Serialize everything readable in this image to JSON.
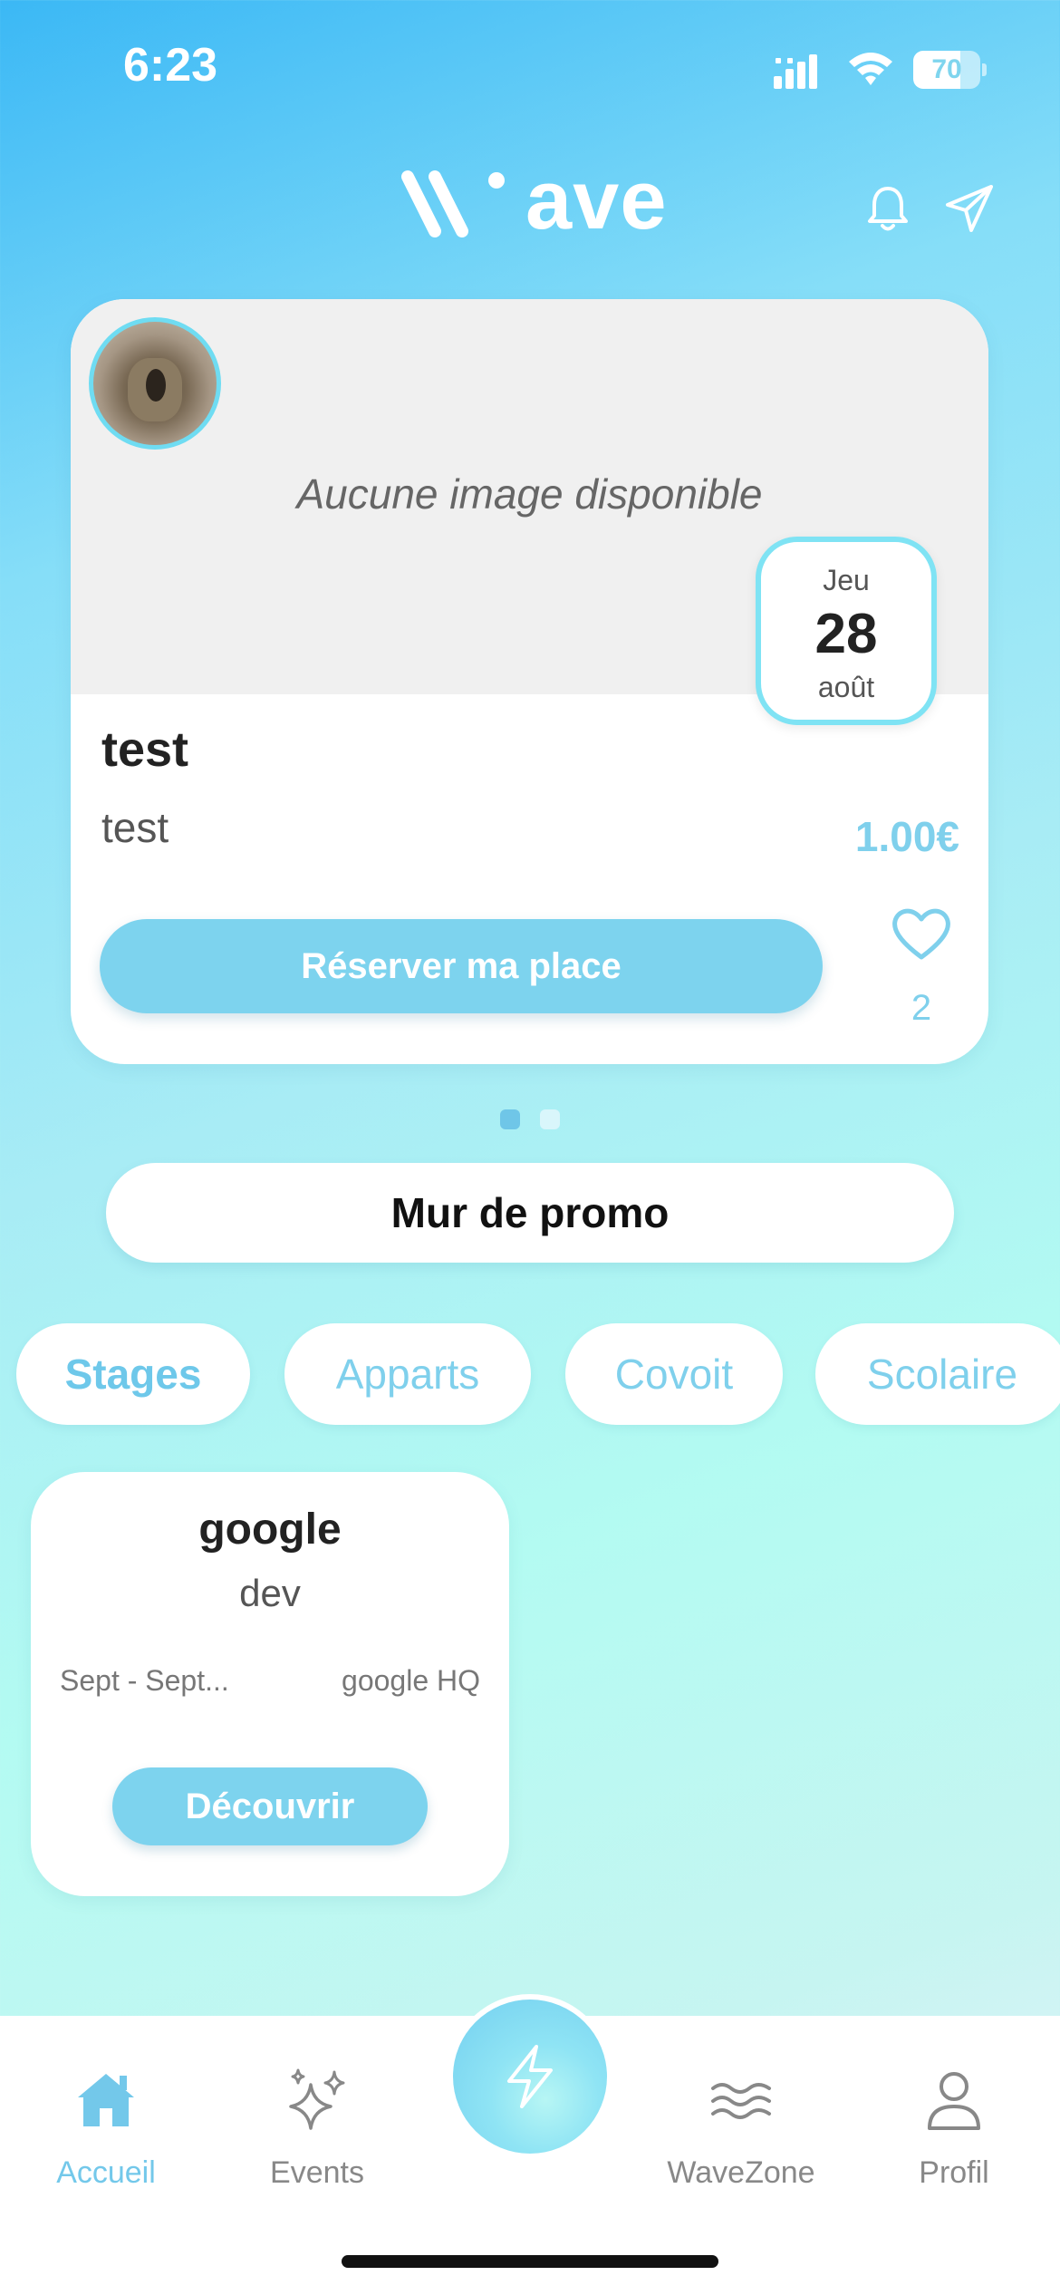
{
  "status_bar": {
    "time": "6:23",
    "battery": "70",
    "battery_level": 0.7
  },
  "header": {
    "logo_text": "ave"
  },
  "event": {
    "no_image_text": "Aucune image disponible",
    "date_day": "Jeu",
    "date_number": "28",
    "date_month": "août",
    "title": "test",
    "description": "test",
    "price": "1.00€",
    "reserve_label": "Réserver ma place",
    "like_count": "2"
  },
  "carousel": {
    "pages": 2,
    "current": 1
  },
  "promo": {
    "label": "Mur de promo"
  },
  "categories": [
    {
      "label": "Stages",
      "active": true
    },
    {
      "label": "Apparts",
      "active": false
    },
    {
      "label": "Covoit",
      "active": false
    },
    {
      "label": "Scolaire",
      "active": false
    }
  ],
  "offer": {
    "company": "google",
    "role": "dev",
    "dates": "Sept - Sept...",
    "location": "google HQ",
    "discover_label": "Découvrir"
  },
  "tab_bar": {
    "items": [
      {
        "label": "Accueil",
        "icon": "home-icon",
        "active": true
      },
      {
        "label": "Events",
        "icon": "sparkles-icon",
        "active": false
      },
      {
        "label": "WaveZone",
        "icon": "waves-icon",
        "active": false
      },
      {
        "label": "Profil",
        "icon": "user-icon",
        "active": false
      }
    ],
    "center_icon": "lightning-icon"
  },
  "colors": {
    "accent": "#7dd3ee",
    "accent_text": "#73c8ea"
  }
}
